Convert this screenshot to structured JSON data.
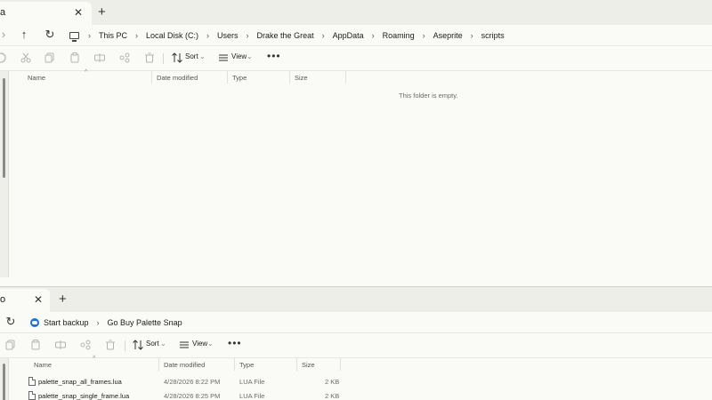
{
  "window1": {
    "tab": {
      "title": "a",
      "close": "✕",
      "new": "+"
    },
    "nav": {
      "back": "›",
      "up": "↑",
      "refresh": "↻"
    },
    "breadcrumbs": [
      "This PC",
      "Local Disk (C:)",
      "Users",
      "Drake the Great",
      "AppData",
      "Roaming",
      "Aseprite",
      "scripts"
    ],
    "separator": "›",
    "toolbar": {
      "sort_label": "Sort",
      "view_label": "View",
      "more": "•••"
    },
    "columns": {
      "name": "Name",
      "date_modified": "Date modified",
      "type": "Type",
      "size": "Size"
    },
    "empty_message": "This folder is empty."
  },
  "window2": {
    "tab": {
      "title": "o",
      "close": "✕",
      "new": "+"
    },
    "nav": {
      "refresh": "↻"
    },
    "breadcrumbs": [
      "Start backup",
      "Go Buy Palette Snap"
    ],
    "separator": "›",
    "toolbar": {
      "sort_label": "Sort",
      "view_label": "View",
      "more": "•••"
    },
    "columns": {
      "name": "Name",
      "date_modified": "Date modified",
      "type": "Type",
      "size": "Size"
    },
    "files": [
      {
        "name": "palette_snap_all_frames.lua",
        "date": "4/28/2026 8:22 PM",
        "type": "LUA File",
        "size": "2 KB"
      },
      {
        "name": "palette_snap_single_frame.lua",
        "date": "4/28/2026 8:25 PM",
        "type": "LUA File",
        "size": "2 KB"
      }
    ]
  },
  "colors": {
    "background": "#fafaf6",
    "tabbar": "#eeeee9",
    "accent": "#1e6fd9"
  }
}
